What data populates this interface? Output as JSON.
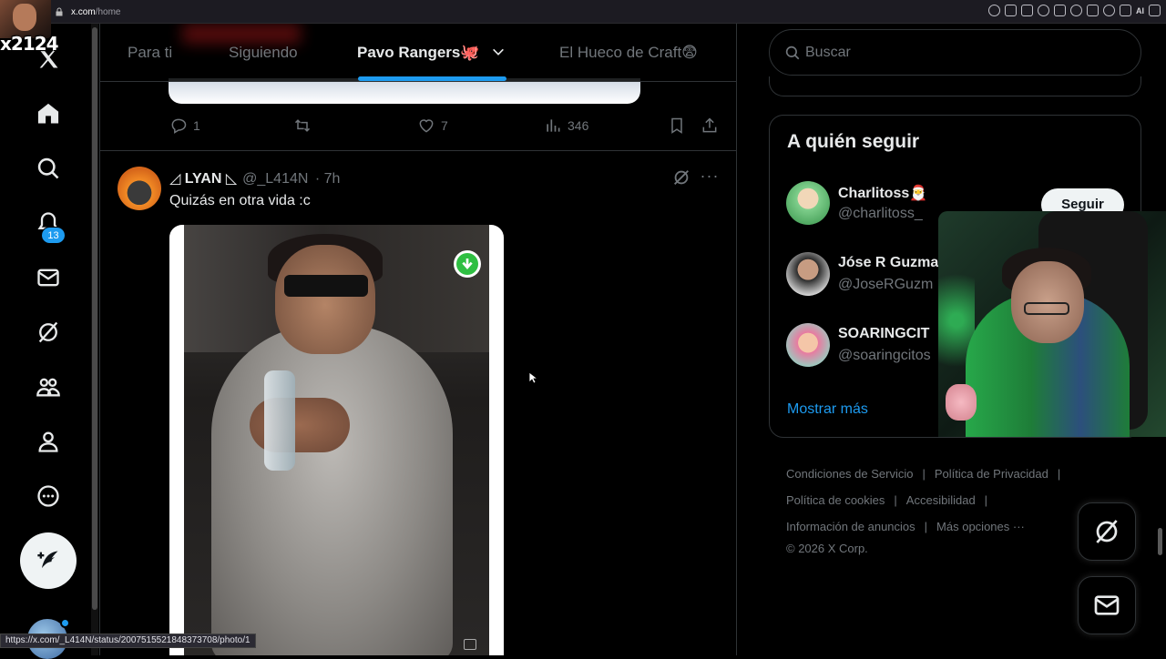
{
  "browser": {
    "host": "x.com",
    "path": "/home",
    "ai_label": "AI"
  },
  "overlay": {
    "stream_tag": "x2124"
  },
  "nav": {
    "notifications_badge": "13"
  },
  "tabs": [
    {
      "label": "Para ti"
    },
    {
      "label": "Siguiendo"
    },
    {
      "label": "Pavo Rangers🐙"
    },
    {
      "label": "El Hueco de Craft😨"
    }
  ],
  "prev_tweet": {
    "replies": "1",
    "likes": "7",
    "views": "346"
  },
  "tweet": {
    "name": "◿ LYAN ◺",
    "handle": "@_L414N",
    "time": "· 7h",
    "text": "Quizás en otra vida :c"
  },
  "search": {
    "placeholder": "Buscar"
  },
  "who_to_follow": {
    "title": "A quién seguir",
    "follow_label": "Seguir",
    "show_more": "Mostrar más",
    "accounts": [
      {
        "name": "Charlitoss🎅",
        "handle": "@charlitoss_",
        "avatar_color": "#7fcf8c"
      },
      {
        "name": "Jóse R Guzma",
        "handle": "@JoseRGuzm",
        "avatar_color": "#d9d9d9"
      },
      {
        "name": "SOARINGCIT",
        "handle": "@soaringcitos",
        "avatar_color": "#e97aa0"
      }
    ]
  },
  "footer": {
    "terms": "Condiciones de Servicio",
    "privacy": "Política de Privacidad",
    "cookies": "Política de cookies",
    "accessibility": "Accesibilidad",
    "ads_info": "Información de anuncios",
    "more": "Más opciones ···",
    "copyright": "© 2026 X Corp."
  },
  "status_bar": {
    "url": "https://x.com/_L414N/status/2007515521848373708/photo/1"
  },
  "colors": {
    "accent": "#1d9bf0",
    "background": "#000000",
    "muted_text": "#71767b"
  }
}
